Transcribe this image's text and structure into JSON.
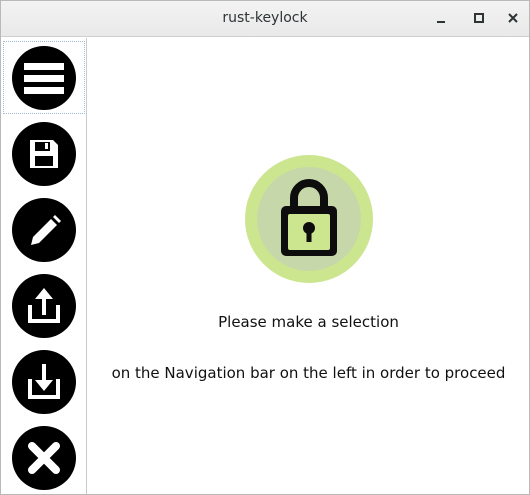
{
  "window": {
    "title": "rust-keylock",
    "controls": {
      "minimize_icon": "minimize-icon",
      "maximize_icon": "maximize-icon",
      "close_icon": "close-icon"
    }
  },
  "sidebar": {
    "items": [
      {
        "icon": "menu-icon",
        "selected": true
      },
      {
        "icon": "save-icon",
        "selected": false
      },
      {
        "icon": "edit-icon",
        "selected": false
      },
      {
        "icon": "export-icon",
        "selected": false
      },
      {
        "icon": "import-icon",
        "selected": false
      },
      {
        "icon": "exit-icon",
        "selected": false
      }
    ]
  },
  "main": {
    "logo_icon": "lock-icon",
    "message_line1": "Please make a selection",
    "message_line2": "on the Navigation bar on the left in order to proceed"
  },
  "colors": {
    "logo_outer": "#cce58f",
    "logo_inner": "#c6d8a9",
    "nav_circle": "#000000"
  }
}
